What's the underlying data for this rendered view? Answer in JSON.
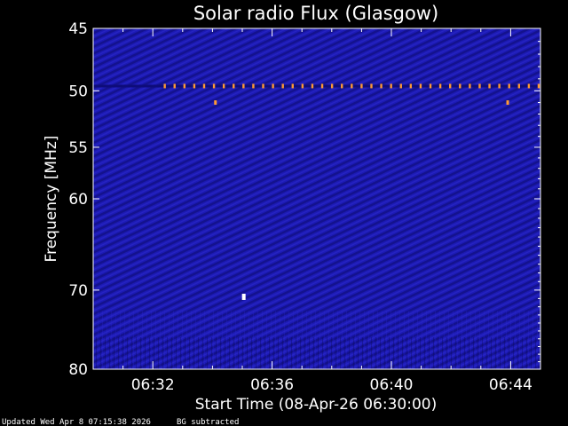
{
  "footer": {
    "updated": "Updated Wed Apr  8 07:15:38 2026",
    "mode": "BG subtracted"
  },
  "chart_data": {
    "type": "heatmap",
    "title": "Solar radio Flux (Glasgow)",
    "xlabel": "Start Time (08-Apr-26 06:30:00)",
    "ylabel": "Frequency [MHz]",
    "x_unit": "minutes after 06:30:00",
    "xlim": [
      0,
      15
    ],
    "ylim": [
      45,
      80
    ],
    "y_scale": "log",
    "x_ticks": [
      {
        "value": 2,
        "label": "06:32"
      },
      {
        "value": 6,
        "label": "06:36"
      },
      {
        "value": 10,
        "label": "06:40"
      },
      {
        "value": 14,
        "label": "06:44"
      }
    ],
    "y_ticks": [
      {
        "value": 45,
        "label": "45"
      },
      {
        "value": 50,
        "label": "50"
      },
      {
        "value": 55,
        "label": "55"
      },
      {
        "value": 60,
        "label": "60"
      },
      {
        "value": 70,
        "label": "70"
      },
      {
        "value": 80,
        "label": "80"
      }
    ],
    "colors": {
      "background": "#000000",
      "spectrogram_base": "#1c1ab4",
      "spectrogram_dark": "#0e0c7a",
      "band_dot": "#ff9a33",
      "hot_spot": "#ffffff"
    },
    "interference_band": {
      "frequency": 49.6,
      "x_start": 2.4,
      "x_end": 15,
      "spacing": 0.33
    },
    "spots": [
      {
        "x": 4.1,
        "frequency": 51.0,
        "color": "#ff9a33"
      },
      {
        "x": 13.9,
        "frequency": 51.0,
        "color": "#ff9a33"
      },
      {
        "x": 5.05,
        "frequency": 70.8,
        "color": "#ffffff"
      }
    ]
  }
}
